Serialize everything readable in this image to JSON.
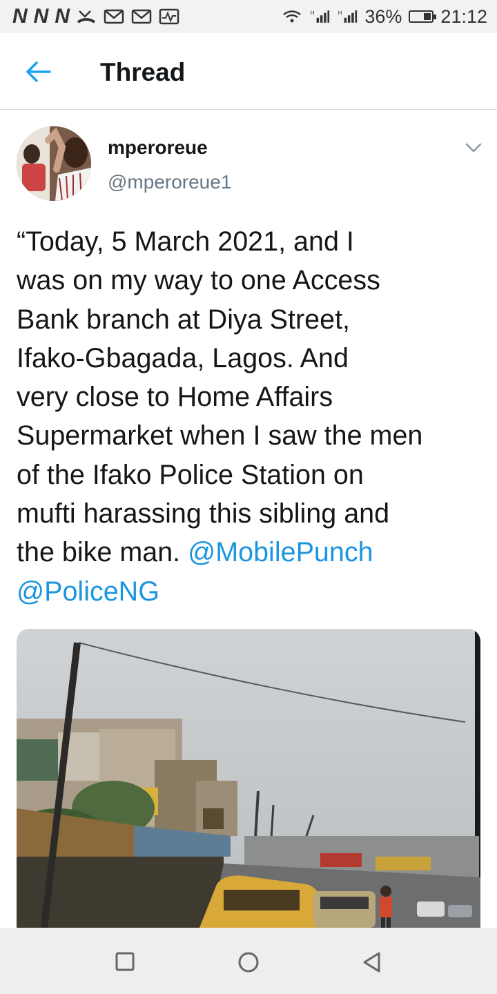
{
  "status_bar": {
    "notif_icons": [
      "N",
      "N",
      "N"
    ],
    "icons": [
      "missed-call-icon",
      "mail-icon",
      "mail-icon",
      "activity-icon",
      "wifi-icon",
      "signal-icon",
      "signal-icon"
    ],
    "battery": "36%",
    "time": "21:12"
  },
  "header": {
    "title": "Thread",
    "back_icon": "back-arrow-icon"
  },
  "tweet": {
    "display_name": "mperoreue",
    "handle": "@mperoreue1",
    "text": "“Today, 5 March 2021, and I\nwas on my way to one Access\nBank branch at Diya Street,\nIfako-Gbagada, Lagos. And\nvery close to Home Affairs\nSupermarket when I saw the men\nof the Ifako Police Station on\nmufti harassing this sibling and\nthe bike man. ",
    "mentions": [
      "@MobilePunch",
      "@PoliceNG"
    ]
  },
  "colors": {
    "link": "#1b95e0",
    "back_arrow": "#1da1f2",
    "secondary_text": "#657786"
  },
  "nav": {
    "icons": [
      "recents-square-icon",
      "home-circle-icon",
      "back-triangle-icon"
    ]
  }
}
